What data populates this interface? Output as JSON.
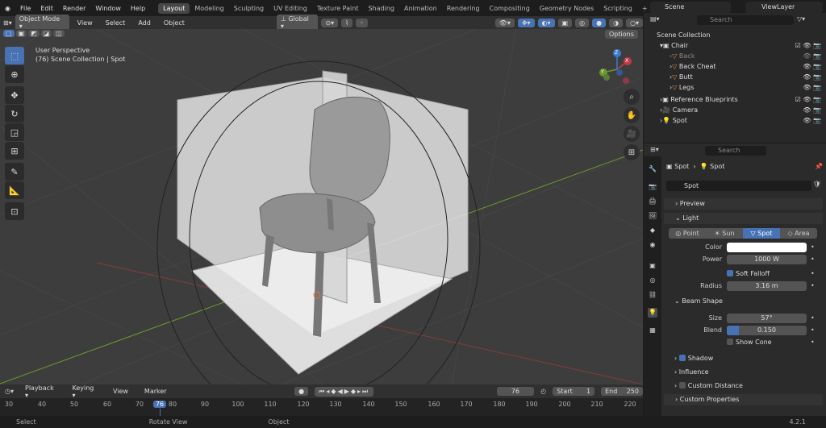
{
  "topbar": {
    "menus": [
      "File",
      "Edit",
      "Render",
      "Window",
      "Help"
    ],
    "workspaces": [
      "Layout",
      "Modeling",
      "Sculpting",
      "UV Editing",
      "Texture Paint",
      "Shading",
      "Animation",
      "Rendering",
      "Compositing",
      "Geometry Nodes",
      "Scripting"
    ],
    "active_workspace": "Layout",
    "scene": "Scene",
    "view_layer": "ViewLayer"
  },
  "viewport_header": {
    "mode": "Object Mode",
    "menus": [
      "View",
      "Select",
      "Add",
      "Object"
    ],
    "transform": "Global",
    "options": "Options"
  },
  "viewport": {
    "line1": "User Perspective",
    "line2": "(76) Scene Collection | Spot"
  },
  "gizmo": {
    "x": "X",
    "y": "Y",
    "z": "Z"
  },
  "timeline": {
    "menus": [
      "Playback",
      "Keying",
      "View",
      "Marker"
    ],
    "current_frame": "76",
    "start_label": "Start",
    "start": "1",
    "end_label": "End",
    "end": "250",
    "ticks": [
      "30",
      "40",
      "50",
      "60",
      "70",
      "76",
      "80",
      "90",
      "100",
      "110",
      "120",
      "130",
      "140",
      "150",
      "160",
      "170",
      "180",
      "190",
      "200",
      "210",
      "220"
    ]
  },
  "statusbar": {
    "select": "Select",
    "rotate": "Rotate View",
    "object": "Object",
    "version": "4.2.1"
  },
  "outliner": {
    "search_placeholder": "Search",
    "items": [
      {
        "label": "Scene Collection"
      },
      {
        "label": "Chair"
      },
      {
        "label": "Back"
      },
      {
        "label": "Back Cheat"
      },
      {
        "label": "Butt"
      },
      {
        "label": "Legs"
      },
      {
        "label": "Reference Blueprints"
      },
      {
        "label": "Camera"
      },
      {
        "label": "Spot"
      }
    ]
  },
  "properties": {
    "search_placeholder": "Search",
    "breadcrumb_obj": "Spot",
    "breadcrumb_data": "Spot",
    "datablock": "Spot",
    "preview": "Preview",
    "light": "Light",
    "light_types": [
      "Point",
      "Sun",
      "Spot",
      "Area"
    ],
    "active_type": "Spot",
    "color_label": "Color",
    "power_label": "Power",
    "power": "1000 W",
    "soft_falloff": "Soft Falloff",
    "radius_label": "Radius",
    "radius": "3.16 m",
    "beam_shape": "Beam Shape",
    "size_label": "Size",
    "size": "57°",
    "blend_label": "Blend",
    "blend": "0.150",
    "blend_fill": 0.15,
    "show_cone": "Show Cone",
    "shadow": "Shadow",
    "influence": "Influence",
    "custom_distance": "Custom Distance",
    "custom_properties": "Custom Properties"
  }
}
